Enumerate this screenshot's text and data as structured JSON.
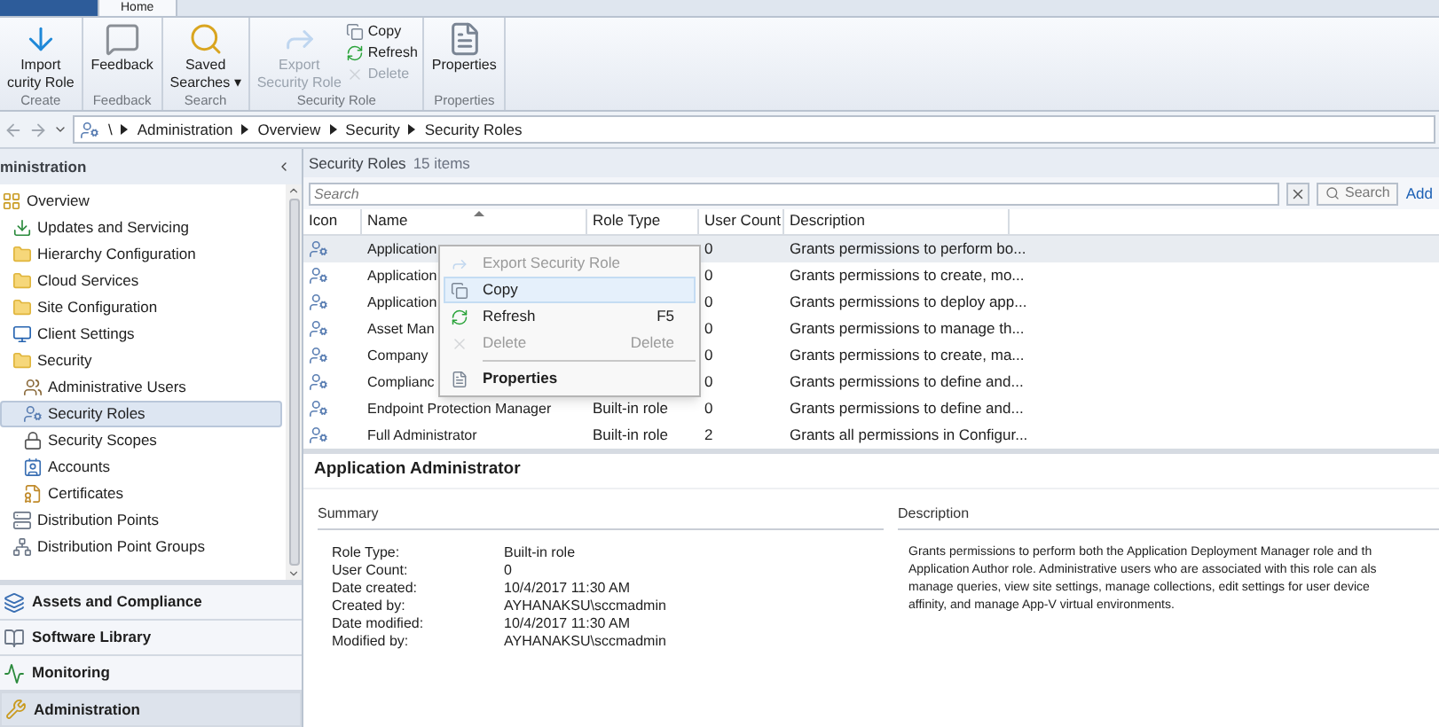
{
  "ribbon": {
    "tabs": [
      {
        "label": "Home",
        "selected": true
      }
    ],
    "groups": [
      {
        "label": "Create",
        "items": [
          {
            "kind": "import",
            "lines": [
              "Import",
              "curity Role"
            ],
            "disabled": false
          }
        ]
      },
      {
        "label": "Feedback",
        "items": [
          {
            "kind": "feedback",
            "lines": [
              "Feedback"
            ],
            "disabled": false
          }
        ]
      },
      {
        "label": "Search",
        "items": [
          {
            "kind": "saved-searches",
            "lines": [
              "Saved",
              "Searches ▾"
            ],
            "disabled": false
          }
        ]
      },
      {
        "label": "Security Role",
        "items": [
          {
            "kind": "export",
            "lines": [
              "Export",
              "Security Role"
            ],
            "disabled": true
          },
          {
            "kind": "copy",
            "lines": [
              "Copy"
            ],
            "disabled": false
          },
          {
            "kind": "refresh",
            "lines": [
              "Refresh"
            ],
            "disabled": false
          },
          {
            "kind": "delete",
            "lines": [
              "Delete"
            ],
            "disabled": true
          }
        ]
      },
      {
        "label": "Properties",
        "items": [
          {
            "kind": "properties",
            "lines": [
              "Properties"
            ],
            "disabled": false
          }
        ]
      }
    ]
  },
  "address_bar": {
    "breadcrumbs": [
      "\\",
      "Administration",
      "Overview",
      "Security",
      "Security Roles"
    ]
  },
  "navigation": {
    "header": "ministration",
    "tree": [
      {
        "label": "Overview",
        "kind": "overview",
        "selected": false,
        "children": [
          {
            "label": "Updates and Servicing",
            "kind": "updates",
            "selected": false
          },
          {
            "label": "Hierarchy Configuration",
            "kind": "folder",
            "selected": false
          },
          {
            "label": "Cloud Services",
            "kind": "folder",
            "selected": false
          },
          {
            "label": "Site Configuration",
            "kind": "folder",
            "selected": false
          },
          {
            "label": "Client Settings",
            "kind": "client-settings",
            "selected": false
          },
          {
            "label": "Security",
            "kind": "folder",
            "selected": false,
            "children": [
              {
                "label": "Administrative Users",
                "kind": "users",
                "selected": false
              },
              {
                "label": "Security Roles",
                "kind": "role",
                "selected": true
              },
              {
                "label": "Security Scopes",
                "kind": "scope",
                "selected": false
              },
              {
                "label": "Accounts",
                "kind": "accounts",
                "selected": false
              },
              {
                "label": "Certificates",
                "kind": "certificates",
                "selected": false
              }
            ]
          },
          {
            "label": "Distribution Points",
            "kind": "distribution-points",
            "selected": false
          },
          {
            "label": "Distribution Point Groups",
            "kind": "distribution-groups",
            "selected": false
          }
        ]
      }
    ],
    "workspaces": [
      {
        "label": "Assets and Compliance",
        "kind": "assets",
        "selected": false
      },
      {
        "label": "Software Library",
        "kind": "library",
        "selected": false
      },
      {
        "label": "Monitoring",
        "kind": "monitoring",
        "selected": false
      },
      {
        "label": "Administration",
        "kind": "administration",
        "selected": true
      }
    ]
  },
  "list": {
    "title": "Security Roles",
    "count": "15 items",
    "search": {
      "placeholder": "Search",
      "button": "Search",
      "add_link": "Add"
    },
    "columns": [
      {
        "label": "Icon",
        "sorted": false
      },
      {
        "label": "Name",
        "sorted": true
      },
      {
        "label": "Role Type",
        "sorted": false
      },
      {
        "label": "User Count",
        "sorted": false
      },
      {
        "label": "Description",
        "sorted": false
      }
    ],
    "rows": [
      {
        "name": "Application",
        "user_count": "0",
        "description": "Grants permissions to perform bo...",
        "selected": true
      },
      {
        "name": "Application",
        "user_count": "0",
        "description": "Grants permissions to create, mo...",
        "selected": false
      },
      {
        "name": "Application",
        "user_count": "0",
        "description": "Grants permissions to deploy app...",
        "selected": false
      },
      {
        "name": "Asset Man",
        "user_count": "0",
        "description": "Grants permissions to manage th...",
        "selected": false
      },
      {
        "name": "Company",
        "user_count": "0",
        "description": "Grants permissions to create, ma...",
        "selected": false
      },
      {
        "name": "Complianc",
        "user_count": "0",
        "description": "Grants permissions to define and...",
        "selected": false
      },
      {
        "name": "Endpoint Protection Manager",
        "role_type": "Built-in role",
        "user_count": "0",
        "description": "Grants permissions to define and...",
        "selected": false
      },
      {
        "name": "Full Administrator",
        "role_type": "Built-in role",
        "user_count": "2",
        "description": "Grants all permissions in Configur...",
        "selected": false
      }
    ],
    "context_menu": [
      {
        "kind": "item",
        "label": "Export Security Role",
        "disabled": true,
        "selected": false,
        "default": false
      },
      {
        "kind": "item",
        "label": "Copy",
        "disabled": false,
        "selected": true,
        "default": false
      },
      {
        "kind": "item",
        "label": "Refresh",
        "shortcut": "F5",
        "disabled": false,
        "selected": false,
        "default": false
      },
      {
        "kind": "item",
        "label": "Delete",
        "shortcut": "Delete",
        "disabled": true,
        "selected": false,
        "default": false
      },
      {
        "kind": "separator"
      },
      {
        "kind": "item",
        "label": "Properties",
        "disabled": false,
        "selected": false,
        "default": true
      }
    ]
  },
  "details": {
    "title": "Application Administrator",
    "summary": {
      "heading": "Summary",
      "fields": [
        {
          "label": "Role Type:",
          "value": "Built-in role"
        },
        {
          "label": "User Count:",
          "value": "0"
        },
        {
          "label": "Date created:",
          "value": "10/4/2017 11:30 AM"
        },
        {
          "label": "Created by:",
          "value": "AYHANAKSU\\sccmadmin"
        },
        {
          "label": "Date modified:",
          "value": "10/4/2017 11:30 AM"
        },
        {
          "label": "Modified by:",
          "value": "AYHANAKSU\\sccmadmin"
        }
      ]
    },
    "description": {
      "heading": "Description",
      "lines": [
        "Grants permissions to perform both the Application Deployment Manager role and th",
        "Application Author role. Administrative users who are associated with this role can als",
        "manage queries, view site settings, manage collections, edit settings for user device",
        "affinity, and manage App-V virtual environments."
      ]
    }
  }
}
